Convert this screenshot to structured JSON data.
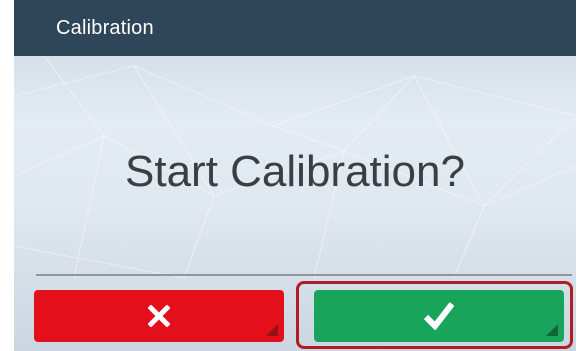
{
  "titlebar": {
    "title": "Calibration"
  },
  "dialog": {
    "prompt": "Start Calibration?"
  },
  "buttons": {
    "cancel_icon": "close-icon",
    "confirm_icon": "checkmark-icon"
  },
  "colors": {
    "titlebar": "#2f4558",
    "cancel": "#e3101c",
    "confirm": "#18a55b",
    "highlight": "#b01e24",
    "prompt_text": "#3b3f44"
  }
}
